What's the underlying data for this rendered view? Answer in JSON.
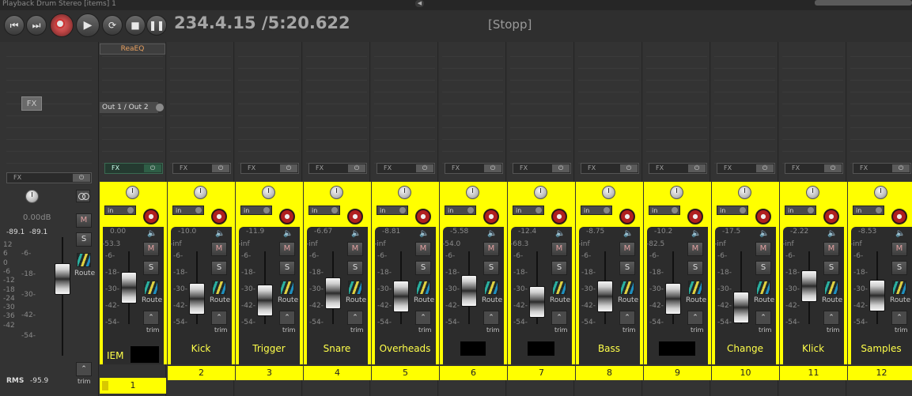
{
  "window": {
    "title": "Playback Drum Stereo [items] 1"
  },
  "transport": {
    "time": "234.4.15 /5:20.622",
    "status": "[Stopp]",
    "buttons": [
      "go-to-start",
      "go-to-end",
      "record",
      "play",
      "repeat",
      "stop",
      "pause"
    ]
  },
  "master": {
    "fx_label": "FX",
    "fx_bar_label": "FX",
    "volume": "0.00dB",
    "peak_left": "-89.1",
    "peak_right": "-89.1",
    "rms_label": "RMS",
    "rms_value": "-95.9",
    "mute_label": "M",
    "solo_label": "S",
    "route_label": "Route",
    "trim_label": "trim",
    "scale_left": [
      "12",
      "6",
      "0",
      "-6",
      "-12",
      "-18",
      "-24",
      "-30",
      "-36",
      "-42"
    ],
    "scale_right": [
      "-6-",
      "-18-",
      "-30-",
      "-42-",
      "-54-"
    ]
  },
  "tracks": [
    {
      "number": "1",
      "name": "IEM",
      "redacted": true,
      "volume": "0.00",
      "peak": "-53.3",
      "fx": "ReaEQ",
      "output": "Out 1 / Out 2",
      "fx_active": true,
      "fader": 0.62
    },
    {
      "number": "2",
      "name": "Kick",
      "volume": "-10.0",
      "peak": "-inf",
      "fader": 0.47
    },
    {
      "number": "3",
      "name": "Trigger",
      "volume": "-11.9",
      "peak": "-inf",
      "fader": 0.44
    },
    {
      "number": "4",
      "name": "Snare",
      "volume": "-6.67",
      "peak": "-inf",
      "fader": 0.55
    },
    {
      "number": "5",
      "name": "Overheads",
      "volume": "-8.81",
      "peak": "-inf",
      "fader": 0.5
    },
    {
      "number": "6",
      "name": "",
      "redacted": true,
      "volume": "-5.58",
      "peak": "-54.0",
      "fader": 0.58
    },
    {
      "number": "7",
      "name": "",
      "redacted": true,
      "volume": "-12.4",
      "peak": "-68.3",
      "fader": 0.42
    },
    {
      "number": "8",
      "name": "Bass",
      "volume": "-8.75",
      "peak": "-inf",
      "fader": 0.5
    },
    {
      "number": "9",
      "name": "",
      "redacted": true,
      "volume": "-10.2",
      "peak": "-82.5",
      "fader": 0.47
    },
    {
      "number": "10",
      "name": "Change",
      "volume": "-17.5",
      "peak": "-inf",
      "fader": 0.35
    },
    {
      "number": "11",
      "name": "Klick",
      "volume": "-2.22",
      "peak": "-inf",
      "fader": 0.65
    },
    {
      "number": "12",
      "name": "Samples",
      "volume": "-8.53",
      "peak": "-inf",
      "fader": 0.51
    }
  ],
  "strip_labels": {
    "fx": "FX",
    "power": "⏻",
    "input": "in",
    "mute": "M",
    "solo": "S",
    "route": "Route",
    "trim": "trim",
    "scale": [
      "-inf",
      "-6-",
      "-18-",
      "-30-",
      "-42-",
      "-54-"
    ]
  }
}
